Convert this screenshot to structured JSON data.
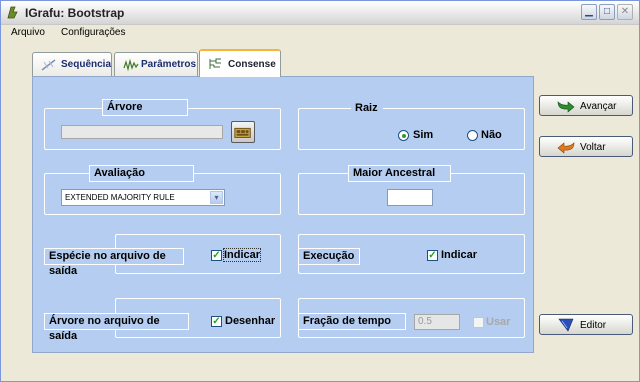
{
  "window": {
    "title": "IGrafu: Bootstrap"
  },
  "menu": {
    "items": [
      "Arquivo",
      "Configurações"
    ]
  },
  "tabs": [
    {
      "label": "Sequência"
    },
    {
      "label": "Parâmetros"
    },
    {
      "label": "Consense"
    }
  ],
  "active_tab": "Consense",
  "arvore": {
    "title": "Árvore",
    "path_value": ""
  },
  "raiz": {
    "title": "Raiz",
    "options": [
      "Sim",
      "Não"
    ],
    "selected": "Sim"
  },
  "avaliacao": {
    "title": "Avaliação",
    "selected": "EXTENDED MAJORITY RULE"
  },
  "maior_ancestral": {
    "title": "Maior Ancestral",
    "value": ""
  },
  "especie": {
    "label": "Espécie no arquivo de saída",
    "checkbox_label": "Indicar",
    "checked": true
  },
  "execucao": {
    "label": "Execução",
    "checkbox_label": "Indicar",
    "checked": true
  },
  "arvore_saida": {
    "label": "Árvore no arquivo de saída",
    "checkbox_label": "Desenhar",
    "checked": true
  },
  "fracao": {
    "label": "Fração de tempo",
    "value": "0.5",
    "checkbox_label": "Usar",
    "checked": false
  },
  "buttons": {
    "avancar": "Avançar",
    "voltar": "Voltar",
    "editor": "Editor"
  },
  "colors": {
    "panel": "#b4cdf0",
    "tab_accent": "#f5b53d",
    "check_green": "#21a121"
  }
}
